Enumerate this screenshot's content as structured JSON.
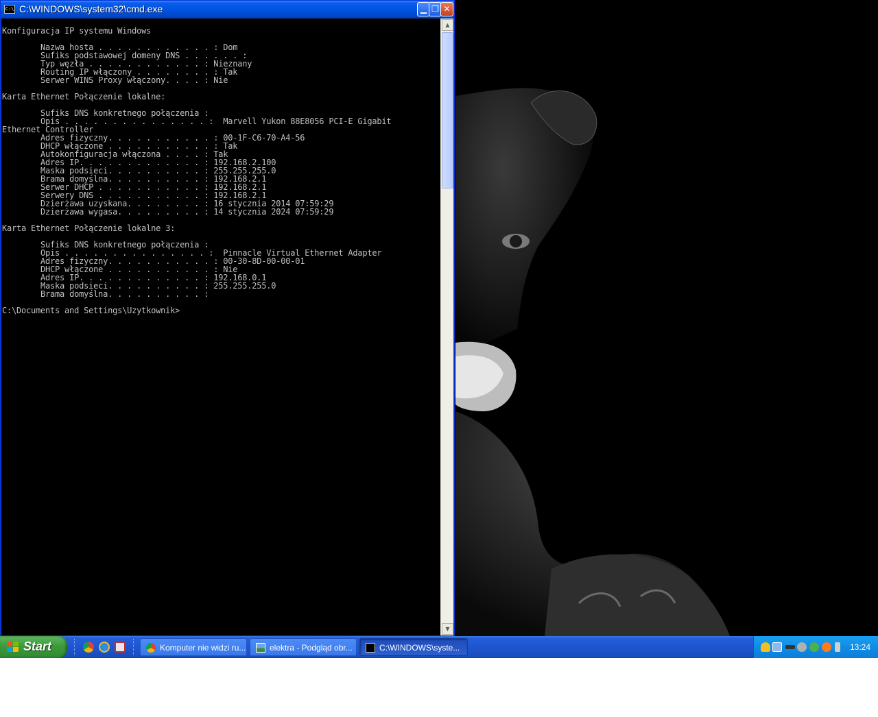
{
  "window": {
    "title": "C:\\WINDOWS\\system32\\cmd.exe",
    "icon_label": "C:\\",
    "buttons": {
      "minimize": "▁",
      "maximize": "❐",
      "close": "✕"
    }
  },
  "console": {
    "lines": [
      "Konfiguracja IP systemu Windows",
      "",
      "        Nazwa hosta . . . . . . . . . . . . : Dom",
      "        Sufiks podstawowej domeny DNS . . . . . . :",
      "        Typ węzła . . . . . . . . . . . . : Nieznany",
      "        Routing IP włączony . . . . . . . . : Tak",
      "        Serwer WINS Proxy włączony. . . . : Nie",
      "",
      "Karta Ethernet Połączenie lokalne:",
      "",
      "        Sufiks DNS konkretnego połączenia :",
      "        Opis . . . . . . . . . . . . . . . :  Marvell Yukon 88E8056 PCI-E Gigabit",
      "Ethernet Controller",
      "        Adres fizyczny. . . . . . . . . . . : 00-1F-C6-70-A4-56",
      "        DHCP włączone . . . . . . . . . . . : Tak",
      "        Autokonfiguracja włączona . . . . : Tak",
      "        Adres IP. . . . . . . . . . . . . : 192.168.2.100",
      "        Maska podsieci. . . . . . . . . . : 255.255.255.0",
      "        Brama domyślna. . . . . . . . . . : 192.168.2.1",
      "        Serwer DHCP . . . . . . . . . . . : 192.168.2.1",
      "        Serwery DNS . . . . . . . . . . . : 192.168.2.1",
      "        Dzierżawa uzyskana. . . . . . . . : 16 stycznia 2014 07:59:29",
      "        Dzierżawa wygasa. . . . . . . . . : 14 stycznia 2024 07:59:29",
      "",
      "Karta Ethernet Połączenie lokalne 3:",
      "",
      "        Sufiks DNS konkretnego połączenia :",
      "        Opis . . . . . . . . . . . . . . . :  Pinnacle Virtual Ethernet Adapter",
      "        Adres fizyczny. . . . . . . . . . . : 00-30-8D-00-00-01",
      "        DHCP włączone . . . . . . . . . . . : Nie",
      "        Adres IP. . . . . . . . . . . . . : 192.168.0.1",
      "        Maska podsieci. . . . . . . . . . : 255.255.255.0",
      "        Brama domyślna. . . . . . . . . . :",
      "",
      "C:\\Documents and Settings\\Uzytkownik>"
    ]
  },
  "scrollbar": {
    "up_arrow": "▲",
    "down_arrow": "▼"
  },
  "taskbar": {
    "start_label": "Start",
    "tasks": [
      {
        "label": "Komputer nie widzi ru...",
        "icon": "chrome-icon",
        "active": false
      },
      {
        "label": "elektra - Podgląd obr...",
        "icon": "image-viewer-icon",
        "active": false
      },
      {
        "label": "C:\\WINDOWS\\syste...",
        "icon": "cmd-icon",
        "active": true
      }
    ],
    "clock": "13:24"
  },
  "colors": {
    "console_bg": "#000000",
    "console_fg": "#c0c0c0",
    "titlebar": "#0054e3",
    "taskbar": "#245edb",
    "start_button": "#3c9a3c",
    "tray": "#0f8ce6"
  }
}
